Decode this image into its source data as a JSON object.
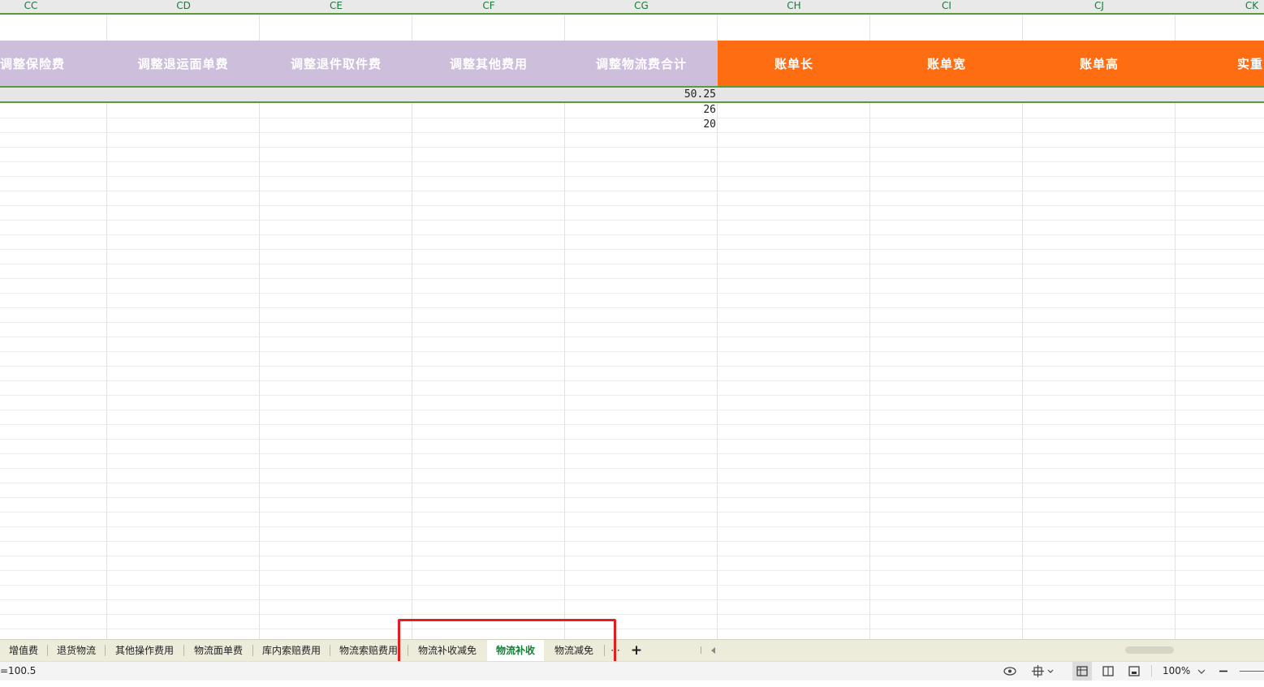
{
  "columns": [
    "CC",
    "CD",
    "CE",
    "CF",
    "CG",
    "CH",
    "CI",
    "CJ",
    "CK"
  ],
  "headers": [
    {
      "text": "调整保险费",
      "color": "#cdbfdc"
    },
    {
      "text": "调整退运面单费",
      "color": "#cdbfdc"
    },
    {
      "text": "调整退件取件费",
      "color": "#cdbfdc"
    },
    {
      "text": "调整其他费用",
      "color": "#cdbfdc"
    },
    {
      "text": "调整物流费合计",
      "color": "#cdbfdc"
    },
    {
      "text": "账单长",
      "color": "#ff6d12"
    },
    {
      "text": "账单宽",
      "color": "#ff6d12"
    },
    {
      "text": "账单高",
      "color": "#ff6d12"
    },
    {
      "text": "实重",
      "color": "#ff6d12"
    }
  ],
  "values": [
    "50.25",
    "26",
    "20"
  ],
  "tabs": {
    "items": [
      "增值费",
      "退货物流",
      "其他操作费用",
      "物流面单费",
      "库内索赔费用",
      "物流索赔费用",
      "物流补收减免",
      "物流补收",
      "物流减免"
    ],
    "active": "物流补收",
    "more": "···",
    "add": "+"
  },
  "status": {
    "formula": "=100.5",
    "zoom": "100%"
  }
}
